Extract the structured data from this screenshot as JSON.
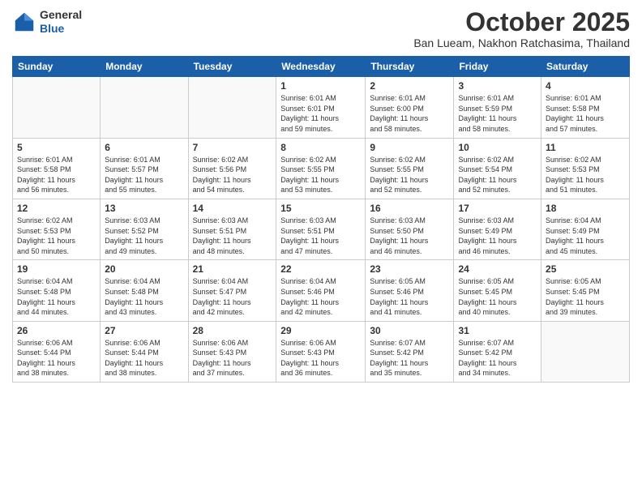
{
  "header": {
    "logo": {
      "general": "General",
      "blue": "Blue"
    },
    "title": "October 2025",
    "subtitle": "Ban Lueam, Nakhon Ratchasima, Thailand"
  },
  "days_of_week": [
    "Sunday",
    "Monday",
    "Tuesday",
    "Wednesday",
    "Thursday",
    "Friday",
    "Saturday"
  ],
  "weeks": [
    [
      {
        "day": "",
        "info": ""
      },
      {
        "day": "",
        "info": ""
      },
      {
        "day": "",
        "info": ""
      },
      {
        "day": "1",
        "info": "Sunrise: 6:01 AM\nSunset: 6:01 PM\nDaylight: 11 hours\nand 59 minutes."
      },
      {
        "day": "2",
        "info": "Sunrise: 6:01 AM\nSunset: 6:00 PM\nDaylight: 11 hours\nand 58 minutes."
      },
      {
        "day": "3",
        "info": "Sunrise: 6:01 AM\nSunset: 5:59 PM\nDaylight: 11 hours\nand 58 minutes."
      },
      {
        "day": "4",
        "info": "Sunrise: 6:01 AM\nSunset: 5:58 PM\nDaylight: 11 hours\nand 57 minutes."
      }
    ],
    [
      {
        "day": "5",
        "info": "Sunrise: 6:01 AM\nSunset: 5:58 PM\nDaylight: 11 hours\nand 56 minutes."
      },
      {
        "day": "6",
        "info": "Sunrise: 6:01 AM\nSunset: 5:57 PM\nDaylight: 11 hours\nand 55 minutes."
      },
      {
        "day": "7",
        "info": "Sunrise: 6:02 AM\nSunset: 5:56 PM\nDaylight: 11 hours\nand 54 minutes."
      },
      {
        "day": "8",
        "info": "Sunrise: 6:02 AM\nSunset: 5:55 PM\nDaylight: 11 hours\nand 53 minutes."
      },
      {
        "day": "9",
        "info": "Sunrise: 6:02 AM\nSunset: 5:55 PM\nDaylight: 11 hours\nand 52 minutes."
      },
      {
        "day": "10",
        "info": "Sunrise: 6:02 AM\nSunset: 5:54 PM\nDaylight: 11 hours\nand 52 minutes."
      },
      {
        "day": "11",
        "info": "Sunrise: 6:02 AM\nSunset: 5:53 PM\nDaylight: 11 hours\nand 51 minutes."
      }
    ],
    [
      {
        "day": "12",
        "info": "Sunrise: 6:02 AM\nSunset: 5:53 PM\nDaylight: 11 hours\nand 50 minutes."
      },
      {
        "day": "13",
        "info": "Sunrise: 6:03 AM\nSunset: 5:52 PM\nDaylight: 11 hours\nand 49 minutes."
      },
      {
        "day": "14",
        "info": "Sunrise: 6:03 AM\nSunset: 5:51 PM\nDaylight: 11 hours\nand 48 minutes."
      },
      {
        "day": "15",
        "info": "Sunrise: 6:03 AM\nSunset: 5:51 PM\nDaylight: 11 hours\nand 47 minutes."
      },
      {
        "day": "16",
        "info": "Sunrise: 6:03 AM\nSunset: 5:50 PM\nDaylight: 11 hours\nand 46 minutes."
      },
      {
        "day": "17",
        "info": "Sunrise: 6:03 AM\nSunset: 5:49 PM\nDaylight: 11 hours\nand 46 minutes."
      },
      {
        "day": "18",
        "info": "Sunrise: 6:04 AM\nSunset: 5:49 PM\nDaylight: 11 hours\nand 45 minutes."
      }
    ],
    [
      {
        "day": "19",
        "info": "Sunrise: 6:04 AM\nSunset: 5:48 PM\nDaylight: 11 hours\nand 44 minutes."
      },
      {
        "day": "20",
        "info": "Sunrise: 6:04 AM\nSunset: 5:48 PM\nDaylight: 11 hours\nand 43 minutes."
      },
      {
        "day": "21",
        "info": "Sunrise: 6:04 AM\nSunset: 5:47 PM\nDaylight: 11 hours\nand 42 minutes."
      },
      {
        "day": "22",
        "info": "Sunrise: 6:04 AM\nSunset: 5:46 PM\nDaylight: 11 hours\nand 42 minutes."
      },
      {
        "day": "23",
        "info": "Sunrise: 6:05 AM\nSunset: 5:46 PM\nDaylight: 11 hours\nand 41 minutes."
      },
      {
        "day": "24",
        "info": "Sunrise: 6:05 AM\nSunset: 5:45 PM\nDaylight: 11 hours\nand 40 minutes."
      },
      {
        "day": "25",
        "info": "Sunrise: 6:05 AM\nSunset: 5:45 PM\nDaylight: 11 hours\nand 39 minutes."
      }
    ],
    [
      {
        "day": "26",
        "info": "Sunrise: 6:06 AM\nSunset: 5:44 PM\nDaylight: 11 hours\nand 38 minutes."
      },
      {
        "day": "27",
        "info": "Sunrise: 6:06 AM\nSunset: 5:44 PM\nDaylight: 11 hours\nand 38 minutes."
      },
      {
        "day": "28",
        "info": "Sunrise: 6:06 AM\nSunset: 5:43 PM\nDaylight: 11 hours\nand 37 minutes."
      },
      {
        "day": "29",
        "info": "Sunrise: 6:06 AM\nSunset: 5:43 PM\nDaylight: 11 hours\nand 36 minutes."
      },
      {
        "day": "30",
        "info": "Sunrise: 6:07 AM\nSunset: 5:42 PM\nDaylight: 11 hours\nand 35 minutes."
      },
      {
        "day": "31",
        "info": "Sunrise: 6:07 AM\nSunset: 5:42 PM\nDaylight: 11 hours\nand 34 minutes."
      },
      {
        "day": "",
        "info": ""
      }
    ]
  ]
}
